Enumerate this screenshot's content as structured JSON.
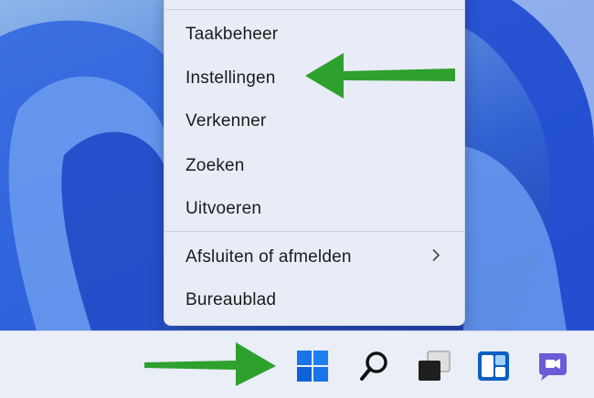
{
  "context_menu": {
    "items": [
      {
        "label": "Taakbeheer"
      },
      {
        "label": "Instellingen"
      },
      {
        "label": "Verkenner"
      },
      {
        "label": "Zoeken"
      },
      {
        "label": "Uitvoeren"
      },
      {
        "label": "Afsluiten of afmelden",
        "submenu_icon": "chevron-right-icon"
      },
      {
        "label": "Bureaublad"
      }
    ]
  },
  "taskbar": {
    "icons": [
      "start-icon",
      "search-icon",
      "task-view-icon",
      "widgets-icon",
      "teams-chat-icon"
    ]
  },
  "colors": {
    "arrow": "#2ea02e",
    "windows_blue": "#1a73e8",
    "menu_bg": "#e8ecf6",
    "taskbar_bg": "#e9eef7"
  }
}
